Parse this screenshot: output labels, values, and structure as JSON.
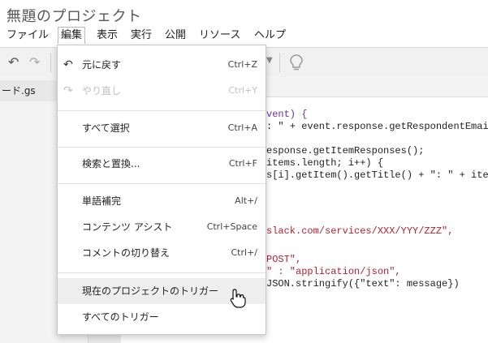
{
  "app": {
    "title": "無題のプロジェクト"
  },
  "menubar": {
    "items": [
      "ファイル",
      "編集",
      "表示",
      "実行",
      "公開",
      "リソース",
      "ヘルプ"
    ],
    "active": "編集"
  },
  "toolbar": {
    "icons": [
      "undo-icon",
      "redo-icon",
      "dropdown-caret-icon",
      "lightbulb-icon"
    ]
  },
  "sidebar": {
    "file": "ード.gs"
  },
  "editor": {
    "lines": [
      "vent) {",
      ": \" + event.response.getRespondentEmai",
      "esponse.getItemResponses();",
      "items.length; i++) {",
      "s[i].getItem().getTitle() + \": \" + item",
      "slack.com/services/XXX/YYY/ZZZ\",",
      "POST\",",
      "\" : \"application/json\",",
      "JSON.stringify({\"text\": message})"
    ]
  },
  "edit_menu": {
    "items": [
      {
        "label": "元に戻す",
        "shortcut": "Ctrl+Z",
        "icon": "undo-icon",
        "disabled": false
      },
      {
        "label": "やり直し",
        "shortcut": "Ctrl+Y",
        "icon": "redo-icon",
        "disabled": true
      },
      {
        "label": "すべて選択",
        "shortcut": "Ctrl+A",
        "disabled": false
      },
      {
        "label": "検索と置換...",
        "shortcut": "Ctrl+F",
        "disabled": false
      },
      {
        "label": "単語補完",
        "shortcut": "Alt+/",
        "disabled": false
      },
      {
        "label": "コンテンツ アシスト",
        "shortcut": "Ctrl+Space",
        "disabled": false
      },
      {
        "label": "コメントの切り替え",
        "shortcut": "Ctrl+/",
        "disabled": false
      },
      {
        "label": "現在のプロジェクトのトリガー",
        "shortcut": "",
        "disabled": false,
        "hovered": true
      },
      {
        "label": "すべてのトリガー",
        "shortcut": "",
        "disabled": false
      }
    ]
  }
}
